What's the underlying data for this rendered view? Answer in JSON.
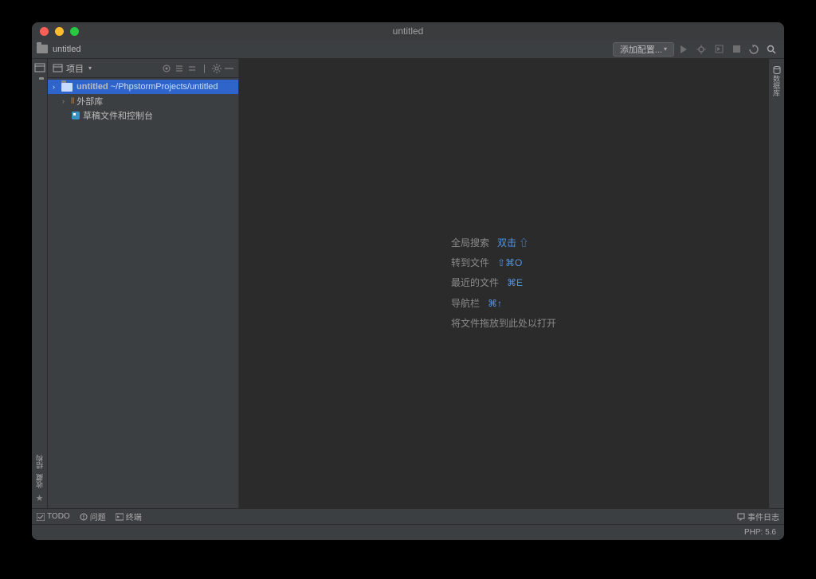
{
  "titlebar": {
    "title": "untitled"
  },
  "navbar": {
    "breadcrumb_project": "untitled",
    "config_button": "添加配置..."
  },
  "sidebar": {
    "header_label": "项目",
    "tree": {
      "root_name": "untitled",
      "root_path": "~/PhpstormProjects/untitled",
      "external_libs": "外部库",
      "scratches": "草稿文件和控制台"
    }
  },
  "editor_tips": {
    "search_label": "全局搜索",
    "search_shortcut": "双击 ⇧",
    "goto_file_label": "转到文件",
    "goto_file_shortcut": "⇧⌘O",
    "recent_files_label": "最近的文件",
    "recent_files_shortcut": "⌘E",
    "navbar_label": "导航栏",
    "navbar_shortcut": "⌘↑",
    "drop_hint": "将文件拖放到此处以打开"
  },
  "left_gutter": {
    "bottom_tab_structure": "结构",
    "bottom_tab_favorites": "收藏"
  },
  "right_gutter": {
    "database": "数据库"
  },
  "bottom_toolbar": {
    "todo": "TODO",
    "problems": "问题",
    "terminal": "终端",
    "event_log": "事件日志"
  },
  "statusbar": {
    "php_version": "PHP: 5.6"
  }
}
